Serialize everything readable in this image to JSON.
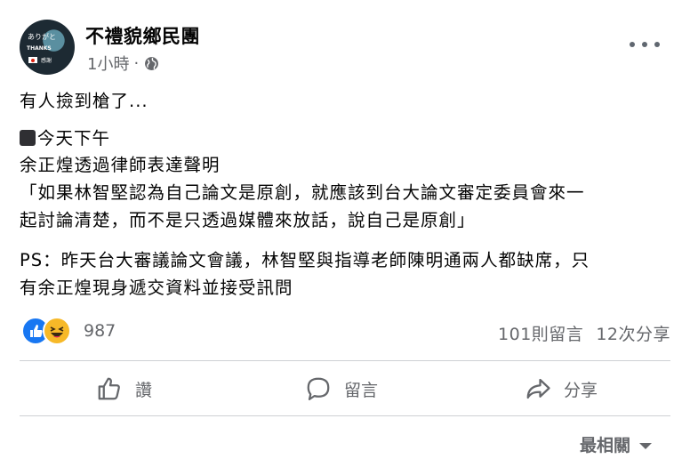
{
  "post": {
    "page_name": "不禮貌鄉民團",
    "time": "1小時",
    "dot": "·",
    "avatar_text": {
      "line1": "ありがと",
      "line2": "THANKS",
      "line3": "感謝"
    },
    "lines": [
      "有人撿到槍了...",
      "今天下午",
      "余正煌透過律師表達聲明",
      "「如果林智堅認為自己論文是原創，就應該到台大論文審定委員會來一",
      "起討論清楚，而不是只透過媒體來放話，說自己是原創」",
      "PS：昨天台大審議論文會議，林智堅與指導老師陳明通兩人都缺席，只",
      "有余正煌現身遞交資料並接受訊問"
    ]
  },
  "stats": {
    "reaction_count": "987",
    "comments": "101則留言",
    "shares": "12次分享"
  },
  "actions": {
    "like": "讚",
    "comment": "留言",
    "share": "分享"
  },
  "sort": {
    "label": "最相關"
  },
  "colors": {
    "like_blue": "#1877f2",
    "haha_yellow": "#f7b928",
    "secondary_text": "#65676b"
  }
}
